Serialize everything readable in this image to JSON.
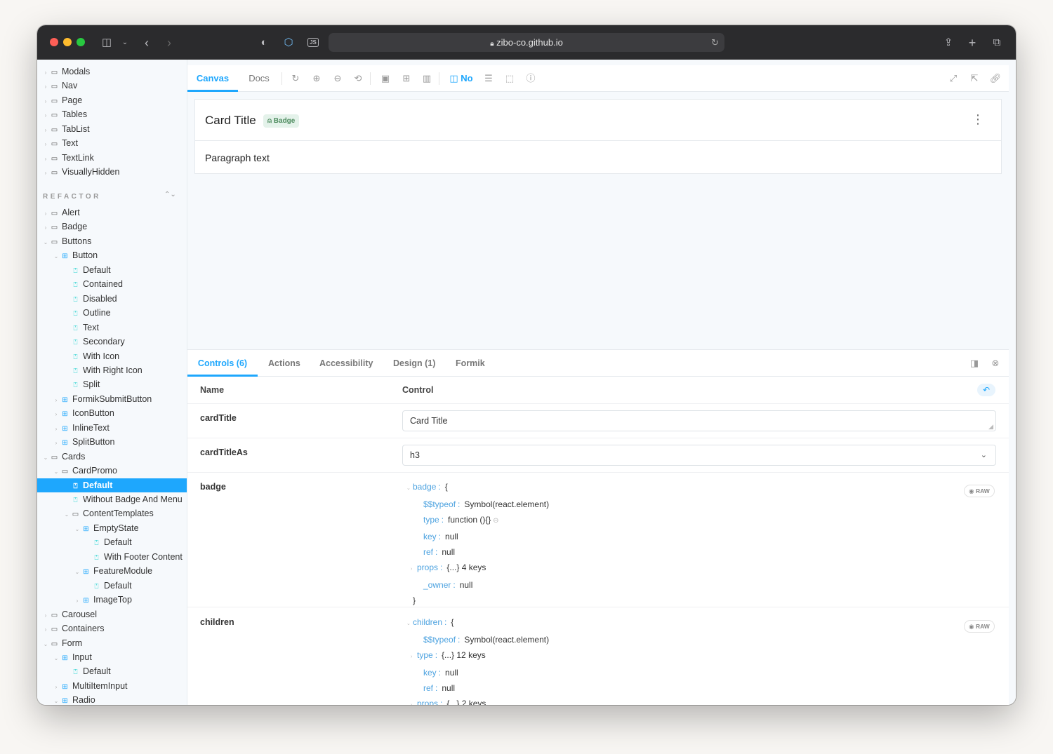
{
  "browser": {
    "url": "zibo-co.github.io"
  },
  "sidebar": {
    "section_title": "REFACTOR",
    "items": [
      {
        "label": "Modals",
        "icon": "folder",
        "depth": 0,
        "arrow": "›"
      },
      {
        "label": "Nav",
        "icon": "folder",
        "depth": 0,
        "arrow": "›"
      },
      {
        "label": "Page",
        "icon": "folder",
        "depth": 0,
        "arrow": "›"
      },
      {
        "label": "Tables",
        "icon": "folder",
        "depth": 0,
        "arrow": "›"
      },
      {
        "label": "TabList",
        "icon": "folder",
        "depth": 0,
        "arrow": "›"
      },
      {
        "label": "Text",
        "icon": "folder",
        "depth": 0,
        "arrow": "›"
      },
      {
        "label": "TextLink",
        "icon": "folder",
        "depth": 0,
        "arrow": "›"
      },
      {
        "label": "VisuallyHidden",
        "icon": "folder",
        "depth": 0,
        "arrow": "›"
      },
      {
        "label": "Alert",
        "icon": "folder",
        "depth": 0,
        "arrow": "›"
      },
      {
        "label": "Badge",
        "icon": "folder",
        "depth": 0,
        "arrow": "›"
      },
      {
        "label": "Buttons",
        "icon": "folder",
        "depth": 0,
        "arrow": "⌄"
      },
      {
        "label": "Button",
        "icon": "component",
        "depth": 1,
        "arrow": "⌄"
      },
      {
        "label": "Default",
        "icon": "story",
        "depth": 2,
        "arrow": ""
      },
      {
        "label": "Contained",
        "icon": "story",
        "depth": 2,
        "arrow": ""
      },
      {
        "label": "Disabled",
        "icon": "story",
        "depth": 2,
        "arrow": ""
      },
      {
        "label": "Outline",
        "icon": "story",
        "depth": 2,
        "arrow": ""
      },
      {
        "label": "Text",
        "icon": "story",
        "depth": 2,
        "arrow": ""
      },
      {
        "label": "Secondary",
        "icon": "story",
        "depth": 2,
        "arrow": ""
      },
      {
        "label": "With Icon",
        "icon": "story",
        "depth": 2,
        "arrow": ""
      },
      {
        "label": "With Right Icon",
        "icon": "story",
        "depth": 2,
        "arrow": ""
      },
      {
        "label": "Split",
        "icon": "story",
        "depth": 2,
        "arrow": ""
      },
      {
        "label": "FormikSubmitButton",
        "icon": "component",
        "depth": 1,
        "arrow": "›"
      },
      {
        "label": "IconButton",
        "icon": "component",
        "depth": 1,
        "arrow": "›"
      },
      {
        "label": "InlineText",
        "icon": "component",
        "depth": 1,
        "arrow": "›"
      },
      {
        "label": "SplitButton",
        "icon": "component",
        "depth": 1,
        "arrow": "›"
      },
      {
        "label": "Cards",
        "icon": "folder",
        "depth": 0,
        "arrow": "⌄"
      },
      {
        "label": "CardPromo",
        "icon": "folder",
        "depth": 1,
        "arrow": "⌄"
      },
      {
        "label": "Default",
        "icon": "story",
        "depth": 2,
        "arrow": "",
        "selected": true
      },
      {
        "label": "Without Badge And Menu",
        "icon": "story",
        "depth": 2,
        "arrow": ""
      },
      {
        "label": "ContentTemplates",
        "icon": "folder",
        "depth": 2,
        "arrow": "⌄"
      },
      {
        "label": "EmptyState",
        "icon": "component",
        "depth": 3,
        "arrow": "⌄"
      },
      {
        "label": "Default",
        "icon": "story",
        "depth": 4,
        "arrow": ""
      },
      {
        "label": "With Footer Content",
        "icon": "story",
        "depth": 4,
        "arrow": ""
      },
      {
        "label": "FeatureModule",
        "icon": "component",
        "depth": 3,
        "arrow": "⌄"
      },
      {
        "label": "Default",
        "icon": "story",
        "depth": 4,
        "arrow": ""
      },
      {
        "label": "ImageTop",
        "icon": "component",
        "depth": 3,
        "arrow": "›"
      },
      {
        "label": "Carousel",
        "icon": "folder",
        "depth": 0,
        "arrow": "›"
      },
      {
        "label": "Containers",
        "icon": "folder",
        "depth": 0,
        "arrow": "›"
      },
      {
        "label": "Form",
        "icon": "folder",
        "depth": 0,
        "arrow": "⌄"
      },
      {
        "label": "Input",
        "icon": "component",
        "depth": 1,
        "arrow": "⌄"
      },
      {
        "label": "Default",
        "icon": "story",
        "depth": 2,
        "arrow": ""
      },
      {
        "label": "MultiItemInput",
        "icon": "component",
        "depth": 1,
        "arrow": "›"
      },
      {
        "label": "Radio",
        "icon": "component",
        "depth": 1,
        "arrow": "⌄"
      }
    ]
  },
  "toolbar": {
    "tab_canvas": "Canvas",
    "tab_docs": "Docs",
    "outline_label": "No"
  },
  "preview": {
    "card_title": "Card Title",
    "badge_label": "Badge",
    "paragraph": "Paragraph text"
  },
  "addons": {
    "tabs": [
      "Controls (6)",
      "Actions",
      "Accessibility",
      "Design (1)",
      "Formik"
    ],
    "col_name": "Name",
    "col_control": "Control",
    "raw_label": "RAW",
    "rows": {
      "cardTitle": {
        "name": "cardTitle",
        "value": "Card Title"
      },
      "cardTitleAs": {
        "name": "cardTitleAs",
        "value": "h3"
      },
      "badge": {
        "name": "badge",
        "lines": [
          {
            "tri": "⌄",
            "key": "badge",
            "sep": ":",
            "val": "{"
          },
          {
            "tri": "",
            "key": "$$typeof",
            "sep": ":",
            "val": "Symbol(react.element)"
          },
          {
            "tri": "",
            "key": "type",
            "sep": ":",
            "val": "function (){}"
          },
          {
            "tri": "",
            "key": "key",
            "sep": ":",
            "val": "null"
          },
          {
            "tri": "",
            "key": "ref",
            "sep": ":",
            "val": "null"
          },
          {
            "tri": "›",
            "key": "props",
            "sep": ":",
            "val": "{...} 4 keys"
          },
          {
            "tri": "",
            "key": "_owner",
            "sep": ":",
            "val": "null"
          },
          {
            "tri": "",
            "key": "",
            "sep": "",
            "val": "}"
          }
        ]
      },
      "children": {
        "name": "children",
        "lines": [
          {
            "tri": "⌄",
            "key": "children",
            "sep": ":",
            "val": "{"
          },
          {
            "tri": "",
            "key": "$$typeof",
            "sep": ":",
            "val": "Symbol(react.element)"
          },
          {
            "tri": "›",
            "key": "type",
            "sep": ":",
            "val": "{...} 12 keys"
          },
          {
            "tri": "",
            "key": "key",
            "sep": ":",
            "val": "null"
          },
          {
            "tri": "",
            "key": "ref",
            "sep": ":",
            "val": "null"
          },
          {
            "tri": "›",
            "key": "props",
            "sep": ":",
            "val": "{...} 2 keys"
          }
        ]
      }
    }
  }
}
